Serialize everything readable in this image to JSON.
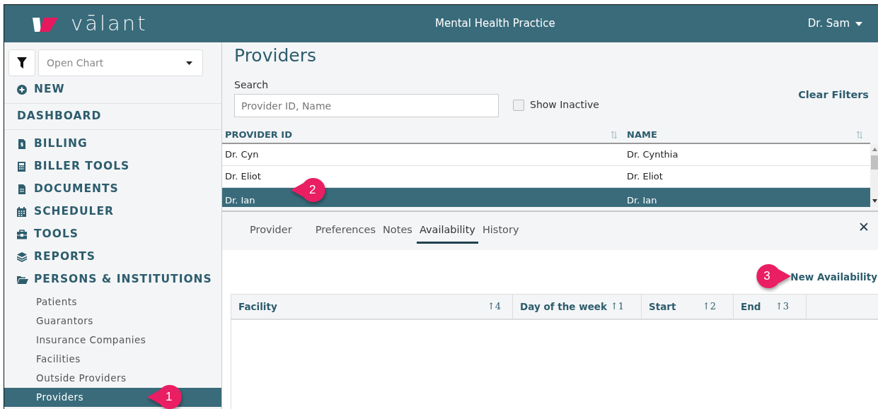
{
  "header": {
    "logo": "vālant",
    "practice": "Mental Health Practice",
    "user": "Dr. Sam"
  },
  "sidebar": {
    "open_chart": {
      "placeholder": "Open Chart"
    },
    "items": [
      {
        "label": "NEW",
        "kind": "action"
      },
      {
        "label": "DASHBOARD",
        "kind": "section"
      },
      {
        "label": "BILLING",
        "kind": "menu"
      },
      {
        "label": "BILLER TOOLS",
        "kind": "menu"
      },
      {
        "label": "DOCUMENTS",
        "kind": "menu"
      },
      {
        "label": "SCHEDULER",
        "kind": "menu"
      },
      {
        "label": "TOOLS",
        "kind": "menu"
      },
      {
        "label": "REPORTS",
        "kind": "menu"
      },
      {
        "label": "PERSONS & INSTITUTIONS",
        "kind": "menu",
        "expanded": true,
        "children": [
          {
            "label": "Patients",
            "selected": false
          },
          {
            "label": "Guarantors",
            "selected": false
          },
          {
            "label": "Insurance Companies",
            "selected": false
          },
          {
            "label": "Facilities",
            "selected": false
          },
          {
            "label": "Outside Providers",
            "selected": false
          },
          {
            "label": "Providers",
            "selected": true,
            "callout": "1"
          }
        ]
      }
    ]
  },
  "page": {
    "title": "Providers",
    "search": {
      "label": "Search",
      "placeholder": "Provider ID, Name"
    },
    "show_inactive": {
      "label": "Show Inactive",
      "checked": false
    },
    "clear_filters": "Clear Filters",
    "table": {
      "columns": [
        "PROVIDER ID",
        "NAME"
      ],
      "rows": [
        {
          "cells": [
            "Dr. Cyn",
            "Dr. Cynthia"
          ],
          "selected": false
        },
        {
          "cells": [
            "Dr. Eliot",
            "Dr. Eliot"
          ],
          "selected": false
        },
        {
          "cells": [
            "Dr. Ian",
            "Dr. Ian"
          ],
          "selected": true,
          "callout": "2"
        }
      ]
    }
  },
  "detail": {
    "tabs": [
      {
        "label": "Provider",
        "selected": false
      },
      {
        "label": "Preferences",
        "selected": false
      },
      {
        "label": "Notes",
        "selected": false
      },
      {
        "label": "Availability",
        "selected": true
      },
      {
        "label": "History",
        "selected": false
      }
    ],
    "close": "✕",
    "new_availability": {
      "label": "New Availability",
      "callout": "3"
    },
    "grid": {
      "columns": [
        {
          "label": "Facility",
          "sort": "↑4"
        },
        {
          "label": "Day of the week",
          "sort": "↑1"
        },
        {
          "label": "Start",
          "sort": "↑2"
        },
        {
          "label": "End",
          "sort": "↑3"
        }
      ]
    }
  }
}
